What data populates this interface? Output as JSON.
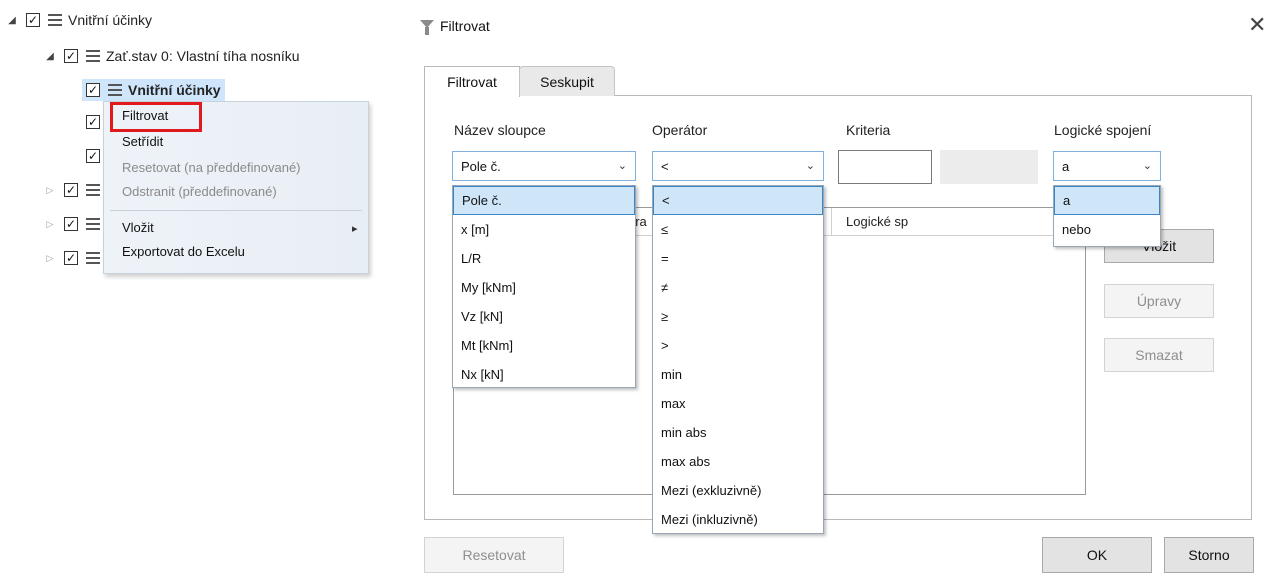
{
  "tree": {
    "root_label": "Vnitřní účinky",
    "loadcase_label": "Zať.stav 0: Vlastní tíha nosníku",
    "selected_label": "Vnitřní účinky",
    "check_mark": "✓"
  },
  "context_menu": {
    "items": [
      {
        "label": "Filtrovat",
        "enabled": true
      },
      {
        "label": "Setřídit",
        "enabled": true
      },
      {
        "label": "Resetovat (na předdefinované)",
        "enabled": false
      },
      {
        "label": "Odstranit (předdefinované)",
        "enabled": false
      },
      {
        "label": "Vložit",
        "enabled": true,
        "submenu": true
      },
      {
        "label": "Exportovat do Excelu",
        "enabled": true
      }
    ],
    "submenu_arrow": "▸"
  },
  "dialog": {
    "title": "Filtrovat",
    "close_symbol": "✕",
    "tabs": [
      {
        "label": "Filtrovat",
        "active": true
      },
      {
        "label": "Seskupit",
        "active": false
      }
    ],
    "fields": {
      "column_name_label": "Název sloupce",
      "operator_label": "Operátor",
      "criteria_label": "Kriteria",
      "logic_label": "Logické spojení",
      "column_value": "Pole č.",
      "operator_value": "<",
      "criteria_value": "",
      "logic_value": "a"
    },
    "column_options": [
      "Pole č.",
      "x [m]",
      "L/R",
      "My [kNm]",
      "Vz [kN]",
      "Mt [kNm]",
      "Nx [kN]"
    ],
    "operator_options": [
      "<",
      "≤",
      "=",
      "≠",
      "≥",
      ">",
      "min",
      "max",
      "min abs",
      "max abs",
      "Mezi (exkluzivně)",
      "Mezi (inkluzivně)"
    ],
    "logic_options": [
      "a",
      "nebo"
    ],
    "grid_headers": {
      "operator_partial": "era",
      "logic_partial": "Logické sp"
    },
    "buttons": {
      "insert": "Vložit",
      "edit": "Úpravy",
      "delete": "Smazat",
      "reset": "Resetovat",
      "ok": "OK",
      "cancel": "Storno"
    },
    "chevron": "⌄"
  },
  "colors": {
    "highlight_red": "#e0191f",
    "selection_blue": "#cfe5f8",
    "focus_border": "#3b86c6"
  }
}
